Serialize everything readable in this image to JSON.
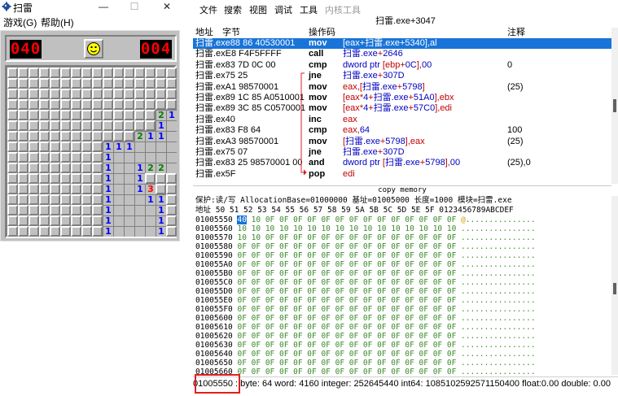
{
  "minesweeper": {
    "title": "扫雷",
    "title_buttons": [
      "—",
      "☐",
      "✕"
    ],
    "menu": [
      "游戏(G)",
      "帮助(H)"
    ],
    "mine_counter": "040",
    "timer": "004",
    "face": "smiley-face",
    "colors": {
      "1": "#0000ff",
      "2": "#008000",
      "3": "#ff0000"
    },
    "grid_rows": [
      "CCCCCCCCCCCCCCCC",
      "CCCCCCCCCCCCCCCC",
      "CCCCCCCCCCCCCCCC",
      "CCCCCCCCCCCCCCCC",
      "CCCCCCCCCCCCCC21",
      "CCCCCCCCCCCCCC1O",
      "CCCCCCCCCCCC211O",
      "CCCCCCCCC111OOOO",
      "CCCCCCCCC1OOOOOO",
      "CCCCCCCCC1OO122O",
      "CCCCCCCCC1OO1CCC",
      "CCCCCCCCC1OO13CC",
      "CCCCCCCCC1OOO11C",
      "CCCCCCCCC1OOOO1C",
      "CCCCCCCCC1OOOO1C",
      "CCCCCCCCC1OOOO1C"
    ]
  },
  "debugger": {
    "menu": [
      "文件",
      "搜索",
      "视图",
      "调试",
      "工具",
      "内核工具"
    ],
    "window_subtitle": "扫雷.exe+3047",
    "columns": {
      "address": "地址",
      "bytes": "字节",
      "opcode": "操作码",
      "comment": "注释"
    },
    "asm_rows": [
      {
        "addr": "扫雷.exe88 86 40530001",
        "op": "mov",
        "operand": "[eax+扫雷.exe+5340],al",
        "comment": "",
        "selected": true
      },
      {
        "addr": "扫雷.exE8 F4F5FFFF",
        "op": "call",
        "operand": "扫雷.exe+2646",
        "comment": ""
      },
      {
        "addr": "扫雷.ex83 7D 0C 00",
        "op": "cmp",
        "operand": "dword ptr [ebp+0C],00",
        "comment": "0"
      },
      {
        "addr": "扫雷.ex75 25",
        "op": "jne",
        "operand": "扫雷.exe+307D",
        "comment": ""
      },
      {
        "addr": "扫雷.exA1 98570001",
        "op": "mov",
        "operand": "eax,[扫雷.exe+5798]",
        "comment": "(25)"
      },
      {
        "addr": "扫雷.ex89 1C 85 A0510001",
        "op": "mov",
        "operand": "[eax*4+扫雷.exe+51A0],ebx",
        "comment": ""
      },
      {
        "addr": "扫雷.ex89 3C 85 C0570001",
        "op": "mov",
        "operand": "[eax*4+扫雷.exe+57C0],edi",
        "comment": ""
      },
      {
        "addr": "扫雷.ex40",
        "op": "inc",
        "operand": "eax",
        "comment": ""
      },
      {
        "addr": "扫雷.ex83 F8 64",
        "op": "cmp",
        "operand": "eax,64",
        "comment": "100"
      },
      {
        "addr": "扫雷.exA3 98570001",
        "op": "mov",
        "operand": "[扫雷.exe+5798],eax",
        "comment": "(25)"
      },
      {
        "addr": "扫雷.ex75 07",
        "op": "jne",
        "operand": "扫雷.exe+307D",
        "comment": ""
      },
      {
        "addr": "扫雷.ex83 25 98570001 00",
        "op": "and",
        "operand": "dword ptr [扫雷.exe+5798],00",
        "comment": "(25),0"
      },
      {
        "addr": "扫雷.ex5F",
        "op": "pop",
        "operand": "edi",
        "comment": ""
      }
    ],
    "copy_memory": "copy memory",
    "memory_info": "保护:读/写  AllocationBase=01000000 基址=01005000 长度=1000 模块=扫雷.exe",
    "memory_header": "地址      50 51 52 53 54 55 56 57 58 59 5A 5B 5C 5D 5E 5F 0123456789ABCDEF",
    "memory_rows": [
      {
        "addr": "01005550",
        "first": "40",
        "bytes": "10 0F 0F 0F 0F 0F 0F 0F 0F 0F 0F 0F 0F 0F 0F",
        "ascii": "@...............",
        "highlight": true
      },
      {
        "addr": "01005560",
        "first": "10",
        "bytes": "10 10 10 10 10 10 10 10 10 10 10 10 10 10 10",
        "ascii": "................"
      },
      {
        "addr": "01005570",
        "first": "10",
        "bytes": "10 0F 0F 0F 0F 0F 0F 0F 0F 0F 0F 0F 0F 0F 0F",
        "ascii": "................"
      },
      {
        "addr": "01005580",
        "first": "0F",
        "bytes": "0F 0F 0F 0F 0F 0F 0F 0F 0F 0F 0F 0F 0F 0F 0F",
        "ascii": "................"
      },
      {
        "addr": "01005590",
        "first": "0F",
        "bytes": "0F 0F 0F 0F 0F 0F 0F 0F 0F 0F 0F 0F 0F 0F 0F",
        "ascii": "................"
      },
      {
        "addr": "010055A0",
        "first": "0F",
        "bytes": "0F 0F 0F 0F 0F 0F 0F 0F 0F 0F 0F 0F 0F 0F 0F",
        "ascii": "................"
      },
      {
        "addr": "010055B0",
        "first": "0F",
        "bytes": "0F 0F 0F 0F 0F 0F 0F 0F 0F 0F 0F 0F 0F 0F 0F",
        "ascii": "................"
      },
      {
        "addr": "010055C0",
        "first": "0F",
        "bytes": "0F 0F 0F 0F 0F 0F 0F 0F 0F 0F 0F 0F 0F 0F 0F",
        "ascii": "................"
      },
      {
        "addr": "010055D0",
        "first": "0F",
        "bytes": "0F 0F 0F 0F 0F 0F 0F 0F 0F 0F 0F 0F 0F 0F 0F",
        "ascii": "................"
      },
      {
        "addr": "010055E0",
        "first": "0F",
        "bytes": "0F 0F 0F 0F 0F 0F 0F 0F 0F 0F 0F 0F 0F 0F 0F",
        "ascii": "................"
      },
      {
        "addr": "010055F0",
        "first": "0F",
        "bytes": "0F 0F 0F 0F 0F 0F 0F 0F 0F 0F 0F 0F 0F 0F 0F",
        "ascii": "................"
      },
      {
        "addr": "01005600",
        "first": "0F",
        "bytes": "0F 0F 0F 0F 0F 0F 0F 0F 0F 0F 0F 0F 0F 0F 0F",
        "ascii": "................"
      },
      {
        "addr": "01005610",
        "first": "0F",
        "bytes": "0F 0F 0F 0F 0F 0F 0F 0F 0F 0F 0F 0F 0F 0F 0F",
        "ascii": "................"
      },
      {
        "addr": "01005620",
        "first": "0F",
        "bytes": "0F 0F 0F 0F 0F 0F 0F 0F 0F 0F 0F 0F 0F 0F 0F",
        "ascii": "................"
      },
      {
        "addr": "01005630",
        "first": "0F",
        "bytes": "0F 0F 0F 0F 0F 0F 0F 0F 0F 0F 0F 0F 0F 0F 0F",
        "ascii": "................"
      },
      {
        "addr": "01005640",
        "first": "0F",
        "bytes": "0F 0F 0F 0F 0F 0F 0F 0F 0F 0F 0F 0F 0F 0F 0F",
        "ascii": "................"
      },
      {
        "addr": "01005650",
        "first": "0F",
        "bytes": "0F 0F 0F 0F 0F 0F 0F 0F 0F 0F 0F 0F 0F 0F 0F",
        "ascii": "................"
      },
      {
        "addr": "01005660",
        "first": "0F",
        "bytes": "0F 0F 0F 0F 0F 0F 0F 0F 0F 0F 0F 0F 0F 0F 0F",
        "ascii": "................"
      }
    ],
    "status": "01005550 : byte: 64 word: 4160 integer: 252645440 int64: 1085102592571150400 float:0.00 double: 0.00",
    "colors": {
      "selection": "#1874d8",
      "operand_register": "#c00000",
      "operand_address": "#0000c0",
      "memory_bytes": "#3a8a2a",
      "highlight_box": "#e02020"
    }
  }
}
